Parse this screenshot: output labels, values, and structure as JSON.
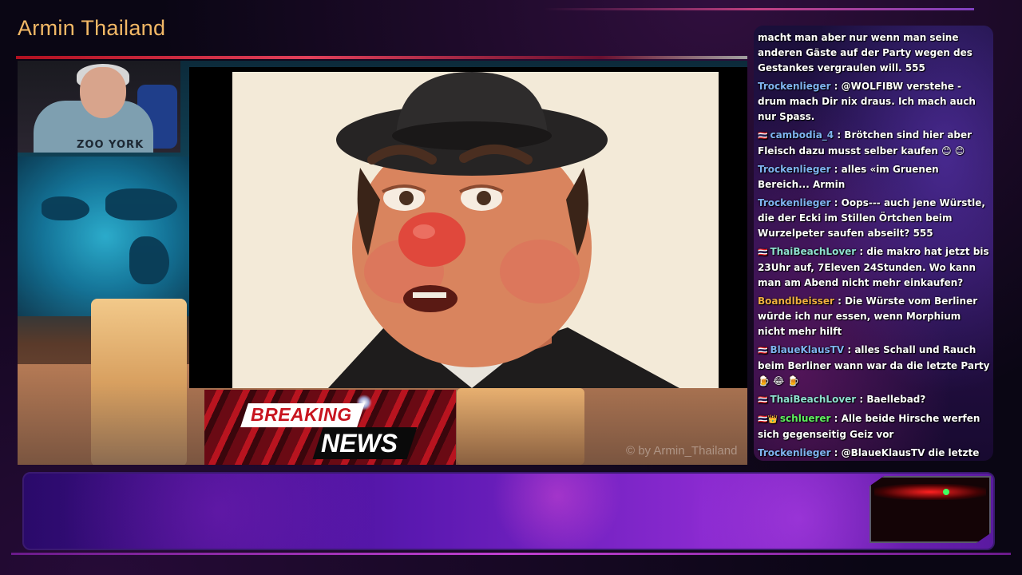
{
  "stream": {
    "channel_title": "Armin Thailand",
    "watermark": "© by Armin_Thailand"
  },
  "webcam": {
    "shirt_text": "ZOO YORK"
  },
  "breaking_news": {
    "line1": "BREAKING",
    "line2": "NEWS"
  },
  "chat": {
    "messages": [
      {
        "flag": "",
        "user": "",
        "user_color": "#ffffff",
        "text": "macht man aber nur wenn man seine anderen Gäste auf der Party wegen des Gestankes vergraulen will. 555"
      },
      {
        "flag": "",
        "user": "Trockenlieger",
        "user_color": "#7fb3f0",
        "text": " : @WOLFIBW verstehe - drum mach Dir nix draus. Ich mach auch nur Spass."
      },
      {
        "flag": "🇹🇭",
        "user": "cambodia_4",
        "user_color": "#7fb3f0",
        "text": " : Brötchen sind hier aber Fleisch dazu musst selber kaufen 😊 😊"
      },
      {
        "flag": "",
        "user": "Trockenlieger",
        "user_color": "#7fb3f0",
        "text": " : alles «im Gruenen Bereich... Armin"
      },
      {
        "flag": "",
        "user": "Trockenlieger",
        "user_color": "#7fb3f0",
        "text": " : Oops--- auch jene Würstle, die der Ecki im Stillen Örtchen beim Wurzelpeter saufen abseilt? 555"
      },
      {
        "flag": "🇹🇭",
        "user": "ThaiBeachLover",
        "user_color": "#8fe0d0",
        "text": " : die makro hat jetzt bis 23Uhr auf, 7Eleven 24Stunden. Wo kann man am Abend nicht mehr einkaufen?"
      },
      {
        "flag": "",
        "user": "Boandlbeisser",
        "user_color": "#f0b040",
        "text": " : Die Würste vom Berliner würde ich nur essen, wenn Morphium nicht mehr hilft"
      },
      {
        "flag": "🇹🇭",
        "user": "BlaueKlausTV",
        "user_color": "#7fb3f0",
        "text": " : alles Schall und Rauch beim Berliner wann war da die letzte Party 🍺 😂 🍺"
      },
      {
        "flag": "🇹🇭",
        "user": "ThaiBeachLover",
        "user_color": "#8fe0d0",
        "text": " : Baellebad?"
      },
      {
        "flag": "🇹🇭👑",
        "user": "schluerer",
        "user_color": "#60f060",
        "text": " : Alle beide Hirsche werfen sich gegenseitig Geiz vor"
      },
      {
        "flag": "",
        "user": "Trockenlieger",
        "user_color": "#7fb3f0",
        "text": " : @BlaueKlausTV die letzte Party beim Ecki war als von der Dada die Familie sich dort einfand und der Ecki gleich der Schwester von der Dada nach deren Hintern wie ein Lüstling grapschte. 555"
      }
    ]
  },
  "colors": {
    "title": "#f2b866",
    "breaking_red": "#c8141f",
    "chat_bg": "#2a1250",
    "bottom_bar": "#5a18b0"
  }
}
